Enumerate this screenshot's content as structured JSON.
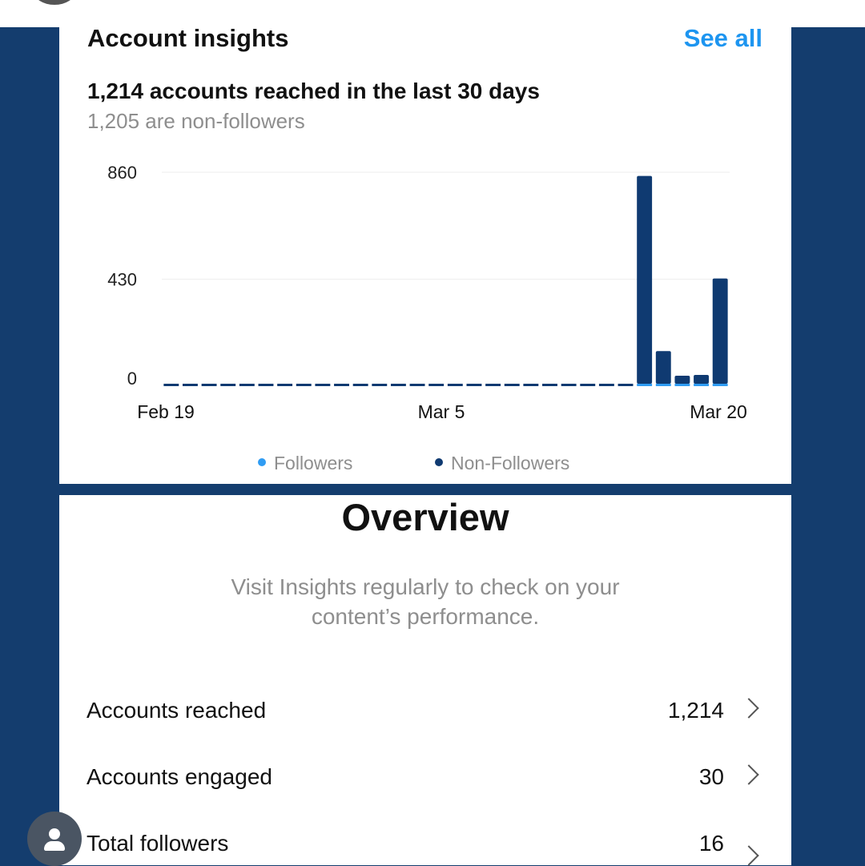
{
  "insights": {
    "title": "Account insights",
    "see_all": "See all",
    "reach_summary": "1,214 accounts reached in the last 30 days",
    "non_followers_summary": "1,205 are non-followers"
  },
  "chart_data": {
    "type": "bar",
    "stacked": true,
    "y_ticks": [
      "860",
      "430",
      "0"
    ],
    "x_ticks": [
      "Feb 19",
      "Mar 5",
      "Mar 20"
    ],
    "ylim": [
      0,
      860
    ],
    "categories": [
      "Feb 19",
      "Feb 20",
      "Feb 21",
      "Feb 22",
      "Feb 23",
      "Feb 24",
      "Feb 25",
      "Feb 26",
      "Feb 27",
      "Feb 28",
      "Mar 1",
      "Mar 2",
      "Mar 3",
      "Mar 4",
      "Mar 5",
      "Mar 6",
      "Mar 7",
      "Mar 8",
      "Mar 9",
      "Mar 10",
      "Mar 11",
      "Mar 12",
      "Mar 13",
      "Mar 14",
      "Mar 15",
      "Mar 16",
      "Mar 17",
      "Mar 18",
      "Mar 19",
      "Mar 20"
    ],
    "series": [
      {
        "name": "Followers",
        "color": "#2f9cf3",
        "values": [
          0,
          0,
          0,
          0,
          0,
          0,
          0,
          0,
          0,
          0,
          0,
          0,
          0,
          0,
          0,
          0,
          0,
          0,
          0,
          0,
          0,
          0,
          0,
          0,
          0,
          2,
          1,
          2,
          2,
          3
        ]
      },
      {
        "name": "Non-Followers",
        "color": "#0f3a71",
        "values": [
          0,
          0,
          0,
          0,
          0,
          0,
          0,
          0,
          0,
          0,
          0,
          0,
          0,
          0,
          0,
          0,
          0,
          0,
          0,
          0,
          0,
          0,
          0,
          0,
          0,
          843,
          140,
          40,
          43,
          430
        ]
      }
    ],
    "legend_position": "bottom",
    "grid": true
  },
  "legend": {
    "followers": "Followers",
    "non_followers": "Non-Followers",
    "followers_color": "#2f9cf3",
    "non_followers_color": "#0f3a71"
  },
  "overview": {
    "title": "Overview",
    "subtitle": "Visit Insights regularly to check on your content’s performance.",
    "rows": [
      {
        "label": "Accounts reached",
        "value": "1,214"
      },
      {
        "label": "Accounts engaged",
        "value": "30"
      },
      {
        "label": "Total followers",
        "value": "16"
      }
    ]
  },
  "icons": {
    "chevron": "chevron-right-icon",
    "profile": "person-icon"
  },
  "colors": {
    "background": "#143d6e",
    "accent": "#1d95f0"
  }
}
